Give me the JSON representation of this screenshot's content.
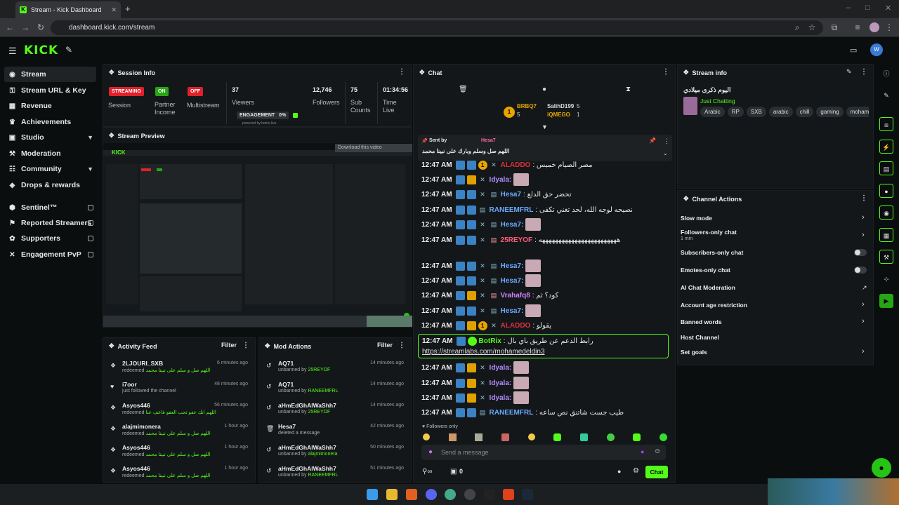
{
  "browser": {
    "tab_title": "Stream - Kick Dashboard",
    "url": "dashboard.kick.com/stream"
  },
  "header": {
    "logo": "KICK",
    "avatar_initial": "W"
  },
  "sidebar": {
    "items": [
      {
        "label": "Stream",
        "icon": "broadcast-icon"
      },
      {
        "label": "Stream URL & Key",
        "icon": "key-icon"
      },
      {
        "label": "Revenue",
        "icon": "revenue-icon"
      },
      {
        "label": "Achievements",
        "icon": "trophy-icon"
      },
      {
        "label": "Studio",
        "icon": "studio-icon"
      },
      {
        "label": "Moderation",
        "icon": "wrench-icon"
      },
      {
        "label": "Community",
        "icon": "community-icon"
      },
      {
        "label": "Drops & rewards",
        "icon": "gift-icon"
      },
      {
        "label": "Sentinel™",
        "icon": "shield-icon"
      },
      {
        "label": "Reported Streamers",
        "icon": "flag-icon"
      },
      {
        "label": "Supporters",
        "icon": "supporters-icon"
      },
      {
        "label": "Engagement PvP",
        "icon": "swords-icon"
      }
    ]
  },
  "session": {
    "title": "Session Info",
    "streaming": "STREAMING",
    "session_label": "Session",
    "on": "ON",
    "partner_label": "Partner Income",
    "off": "OFF",
    "multistream_label": "Multistream",
    "viewers": "37",
    "viewers_label": "Viewers",
    "engagement_label": "ENGAGEMENT",
    "engagement_value": "0%",
    "powered_by": "powered by botrix.live",
    "followers": "12,746",
    "followers_label": "Followers",
    "subs": "75",
    "subs_label": "Sub Counts",
    "time": "01:34:56",
    "time_label": "Time Live"
  },
  "preview": {
    "title": "Stream Preview",
    "download": "Download this video"
  },
  "activity": {
    "title": "Activity Feed",
    "filter": "Filter",
    "rows": [
      {
        "name": "2LJOURI_SXB",
        "sub": "redeemed",
        "reward": "اللهم صل و سلم على نبينا محمد",
        "time": "6 minutes ago"
      },
      {
        "name": "i7oor",
        "sub": "just followed the channel",
        "reward": "",
        "time": "48 minutes ago"
      },
      {
        "name": "Asyos446",
        "sub": "redeemed",
        "reward": "اللهم انك عفو تحب العفو فاعف عنا",
        "time": "56 minutes ago"
      },
      {
        "name": "alajmimonera",
        "sub": "redeemed",
        "reward": "اللهم صل و سلم على نبينا محمد",
        "time": "1 hour ago"
      },
      {
        "name": "Asyos446",
        "sub": "redeemed",
        "reward": "اللهم صل و سلم على نبينا محمد",
        "time": "1 hour ago"
      },
      {
        "name": "Asyos446",
        "sub": "redeemed",
        "reward": "اللهم صل و سلم على نبينا محمد",
        "time": "1 hour ago"
      }
    ]
  },
  "mod": {
    "title": "Mod Actions",
    "filter": "Filter",
    "rows": [
      {
        "name": "AQ71",
        "sub": "unbanned by",
        "target": "25REYOF",
        "time": "14 minutes ago"
      },
      {
        "name": "AQ71",
        "sub": "unbanned by",
        "target": "RANEEMFRL",
        "time": "14 minutes ago"
      },
      {
        "name": "aHmEdGhAlWaShh7",
        "sub": "unbanned by",
        "target": "25REYOF",
        "time": "14 minutes ago"
      },
      {
        "name": "Hesa7",
        "sub": "deleted a message",
        "target": "",
        "time": "42 minutes ago"
      },
      {
        "name": "aHmEdGhAlWaShh7",
        "sub": "unbanned by",
        "target": "alajmimonera",
        "time": "50 minutes ago"
      },
      {
        "name": "aHmEdGhAlWaShh7",
        "sub": "unbanned by",
        "target": "RANEEMFRL",
        "time": "51 minutes ago"
      }
    ]
  },
  "chat": {
    "title": "Chat",
    "top": [
      {
        "name": "BRBQ7",
        "count": "5"
      },
      {
        "name": "SalihD199",
        "count": "5"
      },
      {
        "name": "iQMEGO",
        "count": "1"
      }
    ],
    "pinned_by_label": "Sent by",
    "pinned_user": "Hesa7",
    "pinned_text": "اللهم صل وسلم وبارك على نبينا محمد",
    "messages": [
      {
        "time": "12:47 AM",
        "user": "ALADDO",
        "text": ": مصر الصيام خميس",
        "color": "#e0303c"
      },
      {
        "time": "12:47 AM",
        "user": "Idyala:",
        "text": "",
        "color": "#b28cff"
      },
      {
        "time": "12:47 AM",
        "user": "Hesa7",
        "text": ": تحضر حق الدلع",
        "color": "#6aa9ff"
      },
      {
        "time": "12:47 AM",
        "user": "RANEEMFRL",
        "text": ": نصيحه لوجه الله، لحد تغني تكفى",
        "color": "#6aa9ff"
      },
      {
        "time": "12:47 AM",
        "user": "Hesa7:",
        "text": "",
        "color": "#6aa9ff"
      },
      {
        "time": "12:47 AM",
        "user": "25REYOF",
        "text": ": ههههههههههههههههههههههههه",
        "color": "#ff5b7a"
      },
      {
        "time": "12:47 AM",
        "user": "Hesa7:",
        "text": "",
        "color": "#6aa9ff"
      },
      {
        "time": "12:47 AM",
        "user": "Hesa7:",
        "text": "",
        "color": "#6aa9ff"
      },
      {
        "time": "12:47 AM",
        "user": "Vrahafq8",
        "text": ": كود؟ ثم",
        "color": "#d080ff"
      },
      {
        "time": "12:47 AM",
        "user": "Hesa7:",
        "text": "",
        "color": "#6aa9ff"
      },
      {
        "time": "12:47 AM",
        "user": "ALADDO",
        "text": ": يقولو",
        "color": "#e0303c"
      }
    ],
    "botrix": {
      "time": "12:47 AM",
      "user": "BotRix",
      "text": ": رابط الدعم عن طريق باي بال",
      "link": "https://streamlabs.com/mohamedeldin3"
    },
    "messages2": [
      {
        "time": "12:47 AM",
        "user": "Idyala:",
        "text": "",
        "color": "#b28cff"
      },
      {
        "time": "12:47 AM",
        "user": "Idyala:",
        "text": "",
        "color": "#b28cff"
      },
      {
        "time": "12:47 AM",
        "user": "Idyala:",
        "text": "",
        "color": "#b28cff"
      },
      {
        "time": "12:47 AM",
        "user": "RANEEMFRL",
        "text": ": طيب جست شاتنق نص ساعه",
        "color": "#6aa9ff"
      }
    ],
    "followers_only": "Followers only",
    "placeholder": "Send a message",
    "points": "0",
    "send": "Chat"
  },
  "stream_info": {
    "title": "Stream info",
    "stream_title": "اليوم ذكرى ميلادي",
    "category": "Just Chatting",
    "tags": [
      "Arabic",
      "RP",
      "SXB",
      "arabic",
      "chill",
      "gaming",
      "mohamed"
    ]
  },
  "channel_actions": {
    "title": "Channel Actions",
    "items": [
      {
        "label": "Slow mode",
        "sub": "",
        "control": "arrow"
      },
      {
        "label": "Followers-only chat",
        "sub": "1 min",
        "control": "arrow"
      },
      {
        "label": "Subscribers-only chat",
        "sub": "",
        "control": "toggle"
      },
      {
        "label": "Emotes-only chat",
        "sub": "",
        "control": "toggle"
      },
      {
        "label": "AI Chat Moderation",
        "sub": "",
        "control": "external"
      },
      {
        "label": "Account age restriction",
        "sub": "",
        "control": "arrow"
      },
      {
        "label": "Banned words",
        "sub": "",
        "control": "arrow"
      },
      {
        "label": "Host Channel",
        "sub": "",
        "control": "none"
      },
      {
        "label": "Set goals",
        "sub": "",
        "control": "arrow"
      }
    ]
  },
  "colors": {
    "brand": "#53fc18",
    "live": "#e0202a",
    "bg": "#0b0e0f",
    "panel": "#141719"
  }
}
